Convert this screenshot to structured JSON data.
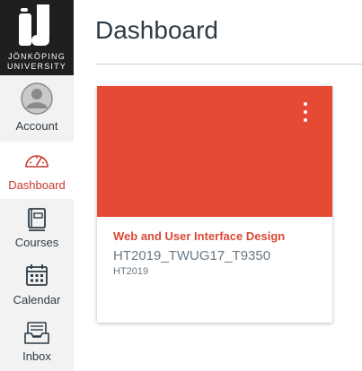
{
  "brand": {
    "line1": "JÖNKÖPING",
    "line2": "UNIVERSITY"
  },
  "nav": {
    "items": [
      {
        "label": "Account",
        "icon": "avatar-icon"
      },
      {
        "label": "Dashboard",
        "icon": "dashboard-icon",
        "active": true
      },
      {
        "label": "Courses",
        "icon": "courses-icon"
      },
      {
        "label": "Calendar",
        "icon": "calendar-icon"
      },
      {
        "label": "Inbox",
        "icon": "inbox-icon"
      }
    ]
  },
  "page": {
    "title": "Dashboard"
  },
  "card": {
    "color": "#e54b34",
    "name": "Web and User Interface Design",
    "code": "HT2019_TWUG17_T9350",
    "term": "HT2019",
    "menu_icon": "more-options-icon"
  },
  "colors": {
    "sidebar_bg": "#f2f2f2",
    "logo_bg": "#1f1f1f",
    "active_accent": "#c8382e"
  }
}
